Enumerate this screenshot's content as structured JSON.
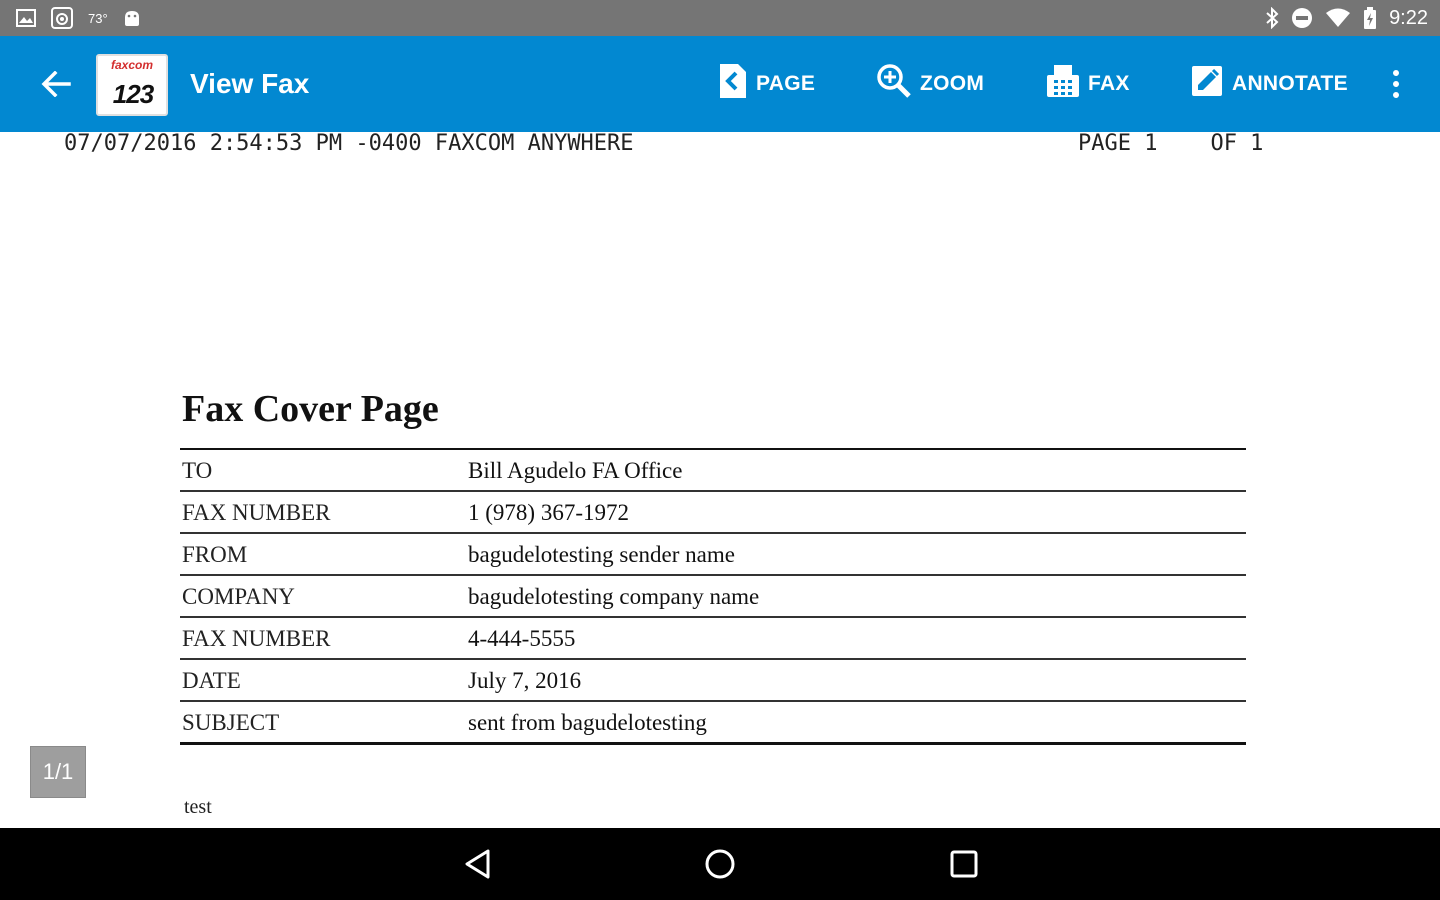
{
  "status_bar": {
    "temperature": "73°",
    "time": "9:22",
    "left_icons": [
      "image-icon",
      "camera-app-icon",
      "android-icon"
    ],
    "right_icons": [
      "bluetooth-icon",
      "do-not-disturb-icon",
      "wifi-icon",
      "battery-icon"
    ]
  },
  "app_bar": {
    "title": "View Fax",
    "logo": {
      "brand": "faxcom",
      "numbers": "123"
    },
    "actions": [
      {
        "id": "page",
        "label": "PAGE",
        "icon": "page-back-icon"
      },
      {
        "id": "zoom",
        "label": "ZOOM",
        "icon": "zoom-in-icon"
      },
      {
        "id": "fax",
        "label": "FAX",
        "icon": "fax-machine-icon"
      },
      {
        "id": "annotate",
        "label": "ANNOTATE",
        "icon": "edit-pencil-icon"
      }
    ],
    "colors": {
      "primary": "#0288d1",
      "on_primary": "#ffffff"
    }
  },
  "document": {
    "fax_header": {
      "left": "07/07/2016 2:54:53 PM -0400 FAXCOM ANYWHERE",
      "right": "PAGE 1    OF 1"
    },
    "cover_title": "Fax Cover Page",
    "rows": [
      {
        "label": "TO",
        "value": "Bill Agudelo FA Office"
      },
      {
        "label": "FAX NUMBER",
        "value": "1 (978) 367-1972"
      },
      {
        "label": "FROM",
        "value": "bagudelotesting sender name"
      },
      {
        "label": "COMPANY",
        "value": "bagudelotesting company name"
      },
      {
        "label": "FAX NUMBER",
        "value": "4-444-5555"
      },
      {
        "label": "DATE",
        "value": "July 7, 2016"
      },
      {
        "label": "SUBJECT",
        "value": "sent from bagudelotesting"
      }
    ],
    "note": "test"
  },
  "page_indicator": "1/1",
  "nav_bar": {
    "buttons": [
      "back-triangle-icon",
      "home-circle-icon",
      "recents-square-icon"
    ]
  }
}
